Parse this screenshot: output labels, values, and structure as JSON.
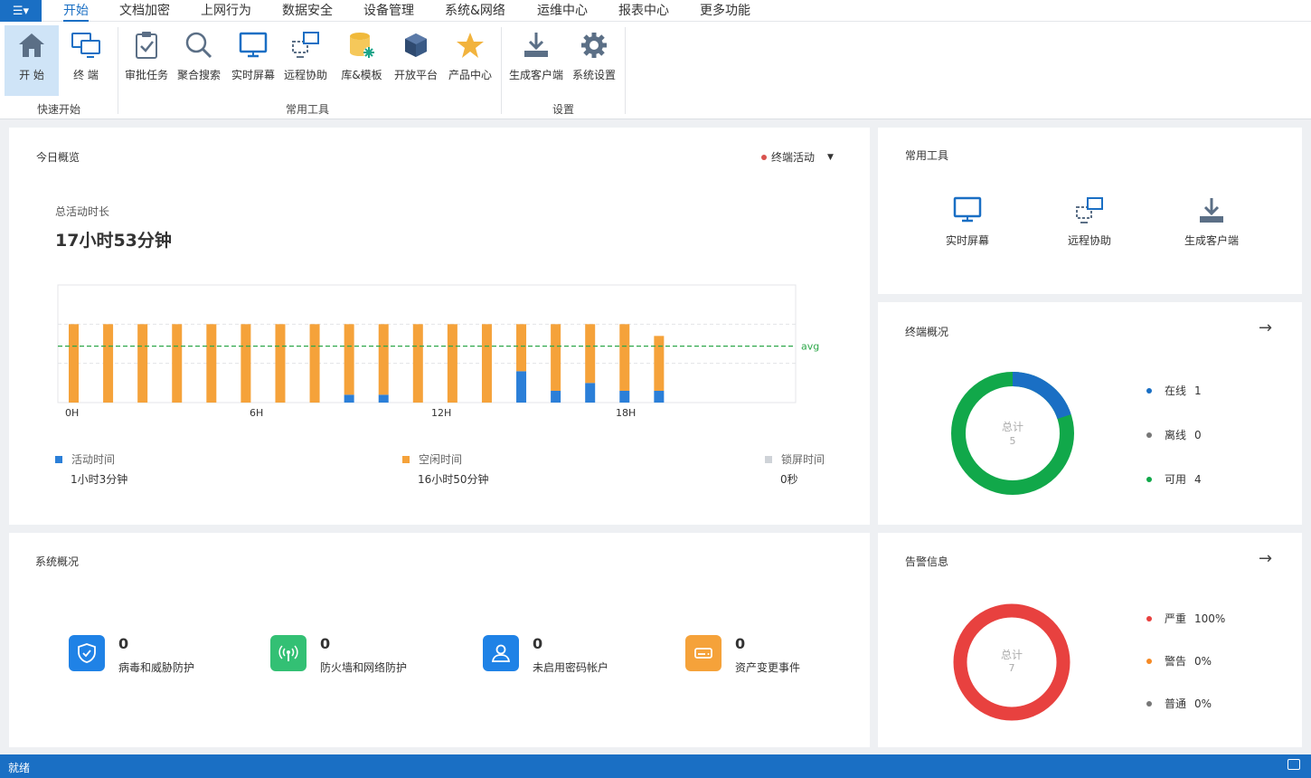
{
  "menubar": {
    "app_icon": "menu-grid-icon",
    "tabs": [
      {
        "label": "开始",
        "active": true
      },
      {
        "label": "文档加密"
      },
      {
        "label": "上网行为"
      },
      {
        "label": "数据安全"
      },
      {
        "label": "设备管理"
      },
      {
        "label": "系统&网络"
      },
      {
        "label": "运维中心"
      },
      {
        "label": "报表中心"
      },
      {
        "label": "更多功能"
      }
    ]
  },
  "ribbon": {
    "groups": [
      {
        "label": "快速开始"
      },
      {
        "label": "常用工具"
      },
      {
        "label": "设置"
      }
    ],
    "items": [
      {
        "label": "开  始",
        "icon": "home-icon"
      },
      {
        "label": "终  端",
        "icon": "terminals-icon"
      },
      {
        "label": "审批任务",
        "icon": "approval-icon"
      },
      {
        "label": "聚合搜索",
        "icon": "search-icon"
      },
      {
        "label": "实时屏幕",
        "icon": "monitor-icon"
      },
      {
        "label": "远程协助",
        "icon": "remote-icon"
      },
      {
        "label": "库&模板",
        "icon": "database-icon"
      },
      {
        "label": "开放平台",
        "icon": "cube-icon"
      },
      {
        "label": "产品中心",
        "icon": "star-icon"
      },
      {
        "label": "生成客户端",
        "icon": "download-icon"
      },
      {
        "label": "系统设置",
        "icon": "gear-icon"
      }
    ]
  },
  "today": {
    "title": "今日概览",
    "filter_label": "终端活动",
    "total_label": "总活动时长",
    "total_value": "17小时53分钟",
    "avg_label": "avg",
    "stats": [
      {
        "label": "活动时间",
        "value": "1小时3分钟",
        "color": "#2b7fd8"
      },
      {
        "label": "空闲时间",
        "value": "16小时50分钟",
        "color": "#f5a23a"
      },
      {
        "label": "锁屏时间",
        "value": "0秒",
        "color": "#cfd3d8"
      }
    ]
  },
  "chart_data": {
    "type": "bar",
    "stacked": true,
    "x_ticks": [
      "0H",
      "6H",
      "12H",
      "18H"
    ],
    "categories": [
      "0",
      "1",
      "2",
      "3",
      "4",
      "5",
      "6",
      "7",
      "8",
      "9",
      "10",
      "11",
      "12",
      "13",
      "14",
      "15",
      "16",
      "17"
    ],
    "series": [
      {
        "name": "活动时间",
        "color": "#2b7fd8",
        "values": [
          0,
          0,
          0,
          0,
          0,
          0,
          0,
          0,
          0.1,
          0.1,
          0,
          0,
          0,
          0.4,
          0.15,
          0.25,
          0.15,
          0.15
        ]
      },
      {
        "name": "空闲时间",
        "color": "#f5a23a",
        "values": [
          1,
          1,
          1,
          1,
          1,
          1,
          1,
          1,
          0.9,
          0.9,
          1,
          1,
          1,
          0.6,
          0.85,
          0.75,
          0.85,
          0.7
        ]
      }
    ],
    "avg": 0.72,
    "ylim": [
      0,
      1.5
    ]
  },
  "tools": {
    "title": "常用工具",
    "items": [
      {
        "label": "实时屏幕",
        "icon": "monitor-icon"
      },
      {
        "label": "远程协助",
        "icon": "remote-icon"
      },
      {
        "label": "生成客户端",
        "icon": "download-icon"
      }
    ]
  },
  "terminals": {
    "title": "终端概况",
    "total_label": "总计",
    "total_value": "5",
    "legend": [
      {
        "label": "在线",
        "value": "1",
        "color": "#1a6fc4"
      },
      {
        "label": "离线",
        "value": "0",
        "color": "#777777"
      },
      {
        "label": "可用",
        "value": "4",
        "color": "#11a84a"
      }
    ]
  },
  "system": {
    "title": "系统概况",
    "items": [
      {
        "value": "0",
        "label": "病毒和威胁防护",
        "icon": "shield-icon",
        "color": "#1f82e6"
      },
      {
        "value": "0",
        "label": "防火墙和网络防护",
        "icon": "wireless-icon",
        "color": "#33c074"
      },
      {
        "value": "0",
        "label": "未启用密码帐户",
        "icon": "user-icon",
        "color": "#1f82e6"
      },
      {
        "value": "0",
        "label": "资产变更事件",
        "icon": "drive-icon",
        "color": "#f5a23a"
      }
    ]
  },
  "alerts": {
    "title": "告警信息",
    "total_label": "总计",
    "total_value": "7",
    "legend": [
      {
        "label": "严重",
        "value": "100%",
        "color": "#e8413f"
      },
      {
        "label": "警告",
        "value": "0%",
        "color": "#f58a25"
      },
      {
        "label": "普通",
        "value": "0%",
        "color": "#777777"
      }
    ]
  },
  "statusbar": {
    "text": "就绪",
    "icon": "notification-icon"
  }
}
